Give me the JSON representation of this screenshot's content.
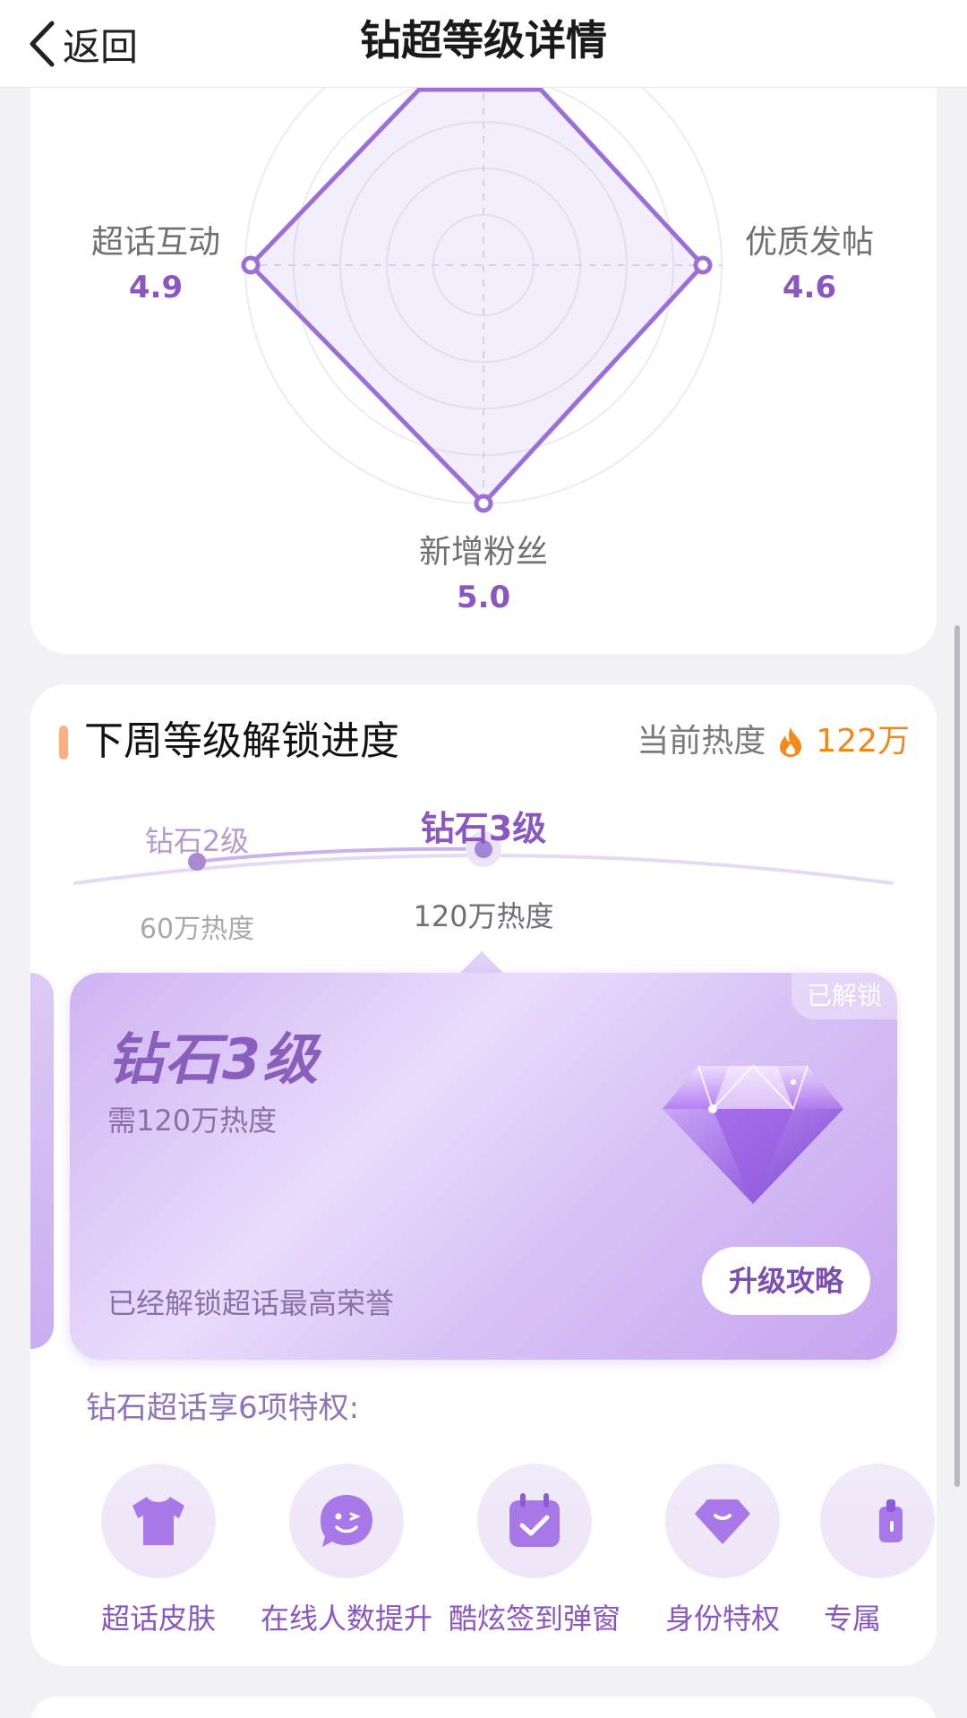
{
  "header": {
    "back_label": "返回",
    "title": "钻超等级详情"
  },
  "radar": {
    "labels": [
      {
        "name": "超话互动",
        "value": "4.9"
      },
      {
        "name": "优质发帖",
        "value": "4.6"
      },
      {
        "name": "新增粉丝",
        "value": "5.0"
      }
    ],
    "accent": "#9b6fd6"
  },
  "progress": {
    "section_title": "下周等级解锁进度",
    "heat_label": "当前热度",
    "heat_value": "122万",
    "levels": [
      {
        "name": "钻石2级",
        "requirement": "60万热度"
      },
      {
        "name": "钻石3级",
        "requirement": "120万热度"
      }
    ]
  },
  "level_card": {
    "badge": "已解锁",
    "title": "钻石3级",
    "requirement": "需120万热度",
    "honor": "已经解锁超话最高荣誉",
    "guide_button": "升级攻略"
  },
  "privileges": {
    "title": "钻石超话享6项特权:",
    "items": [
      {
        "label": "超话皮肤",
        "icon": "tshirt-icon"
      },
      {
        "label": "在线人数提升",
        "icon": "smile-chat-icon"
      },
      {
        "label": "酷炫签到弹窗",
        "icon": "calendar-check-icon"
      },
      {
        "label": "身份特权",
        "icon": "diamond-icon"
      },
      {
        "label": "专属",
        "icon": "badge-icon"
      }
    ]
  },
  "colors": {
    "accent": "#8a56c0",
    "heat": "#f0891a",
    "section_bar": "#ffb083"
  }
}
